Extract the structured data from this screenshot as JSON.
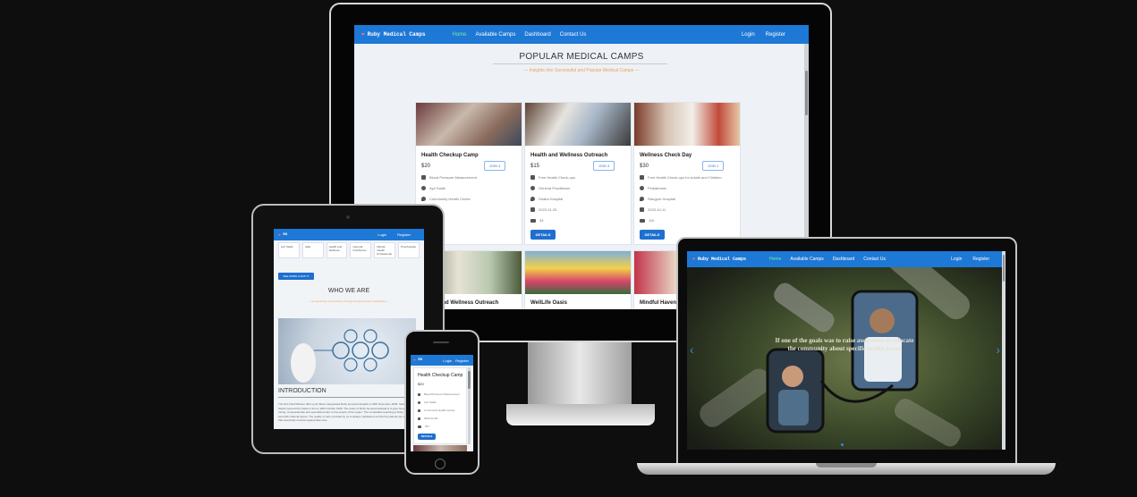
{
  "brand": {
    "name": "Ruby Medical Camps",
    "short": "RU"
  },
  "nav": {
    "links": [
      "Home",
      "Available Camps",
      "Dashboard",
      "Contact Us"
    ],
    "login": "Login",
    "register": "Register"
  },
  "desktop": {
    "title": "POPULAR MEDICAL CAMPS",
    "subtitle": "--- Insights Into Successful and Popular Medical Camps ---",
    "cards": [
      {
        "title": "Health Checkup Camp",
        "price": "$20",
        "join": "JOIN 4",
        "service": "Blood Pressure Measurement",
        "doctor": "Ayri Sadik",
        "place": "Community Health Center",
        "date": "",
        "count": ""
      },
      {
        "title": "Health and Wellness Outreach",
        "price": "$15",
        "join": "JOIN 3",
        "service": "Free Health Check-ups",
        "doctor": "General Practitioner",
        "place": "Dhaka Hospital",
        "date": "2023-11-20",
        "count": "33"
      },
      {
        "title": "Wellness Check Day",
        "price": "$30",
        "join": "JOIN 1",
        "service": "Free Health Check-ups for Adults and Children",
        "doctor": "Pediatrician",
        "place": "Rangpur Hospital",
        "date": "2023-10-11",
        "count": "110"
      }
    ],
    "detail_label": "DETAILS",
    "row2_titles": [
      "Health and Wellness Outreach",
      "WellLife Oasis",
      "Mindful Haven"
    ]
  },
  "laptop": {
    "hero_text": "If one of the goals was to raise awareness or educate the community about specific health issues"
  },
  "tablet": {
    "camps_button": "SEE MORE CAMP ≫",
    "who_title": "WHO WE ARE",
    "who_subtitle": "--- Empowering Communities through Comprehensive Healthcare ---",
    "intro_title": "INTRODUCTION",
    "intro_text": "The first Chief Minister (Mrs Lyric) Bose inaugurated Ruby General Hospital on 29th November 1995. Sekhar Sarkar opened the Garden Unit on 28th October 1996. The vision of Ruby General Hospital is to give honest, caring, compassionate and specialized care to the people of the region. The remarkable teaching at Ruby are the best with national repute. The quality of care provided by us is always maintained so that the patients are assured that everybody receives appropriate care.",
    "chips": [
      "Ayri Sadik",
      "Jalal",
      "Health and Wellness",
      "General Practitioner",
      "Mental Health Professional",
      "Psychologist"
    ]
  },
  "phone": {
    "card": {
      "title": "Health Checkup Camp",
      "price": "$20",
      "service": "Blood Pressure Measurement",
      "doctor": "Ayri Sadik",
      "place": "Community Health Center",
      "date": "2023-11-05",
      "count": "257",
      "detail": "DETAILS"
    }
  },
  "colors": {
    "nav": "#1e78d6",
    "accent": "#e8a25a",
    "button": "#1e6fd0",
    "active_link": "#7be8a0"
  }
}
